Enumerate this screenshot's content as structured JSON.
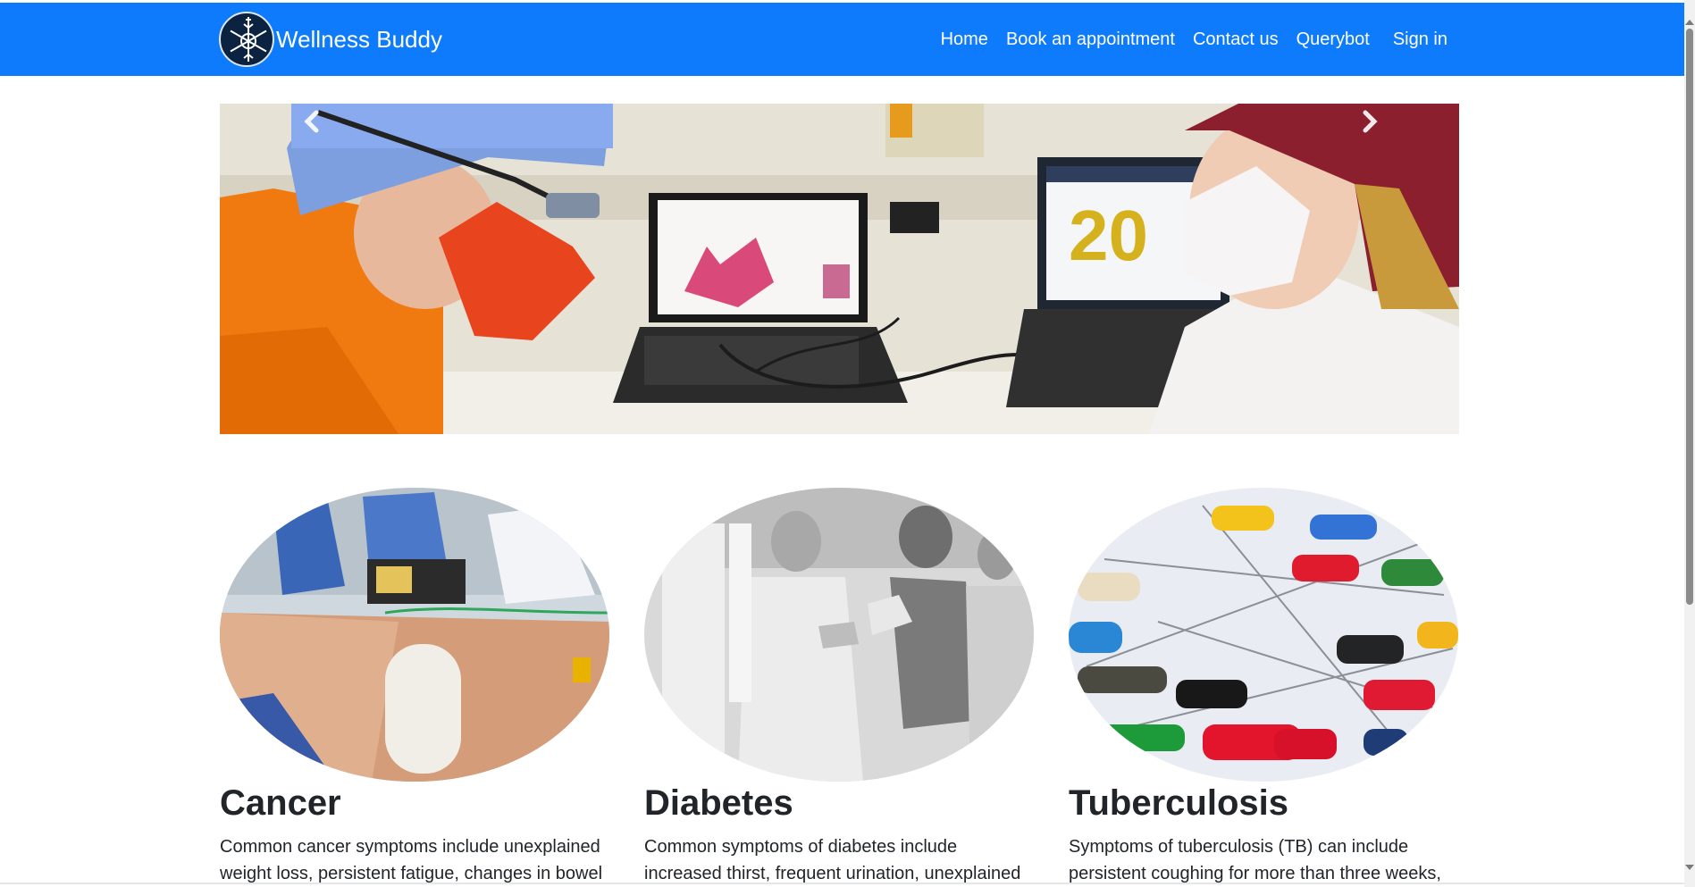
{
  "brand": {
    "name": "Wellness Buddy",
    "logo_icon": "snowflake-emblem-icon"
  },
  "nav": {
    "items": [
      {
        "label": "Home"
      },
      {
        "label": "Book an appointment"
      },
      {
        "label": "Contact us"
      },
      {
        "label": "Querybot"
      }
    ],
    "signin": "Sign in"
  },
  "carousel": {
    "prev_icon": "chevron-left-icon",
    "next_icon": "chevron-right-icon",
    "slide_text": "20"
  },
  "cards": [
    {
      "title": "Cancer",
      "text": "Common cancer symptoms include unexplained weight loss, persistent fatigue, changes in bowel"
    },
    {
      "title": "Diabetes",
      "text": "Common symptoms of diabetes include increased thirst, frequent urination, unexplained"
    },
    {
      "title": "Tuberculosis",
      "text": "Symptoms of tuberculosis (TB) can include persistent coughing for more than three weeks,"
    }
  ],
  "colors": {
    "navbar": "#0d7bfb",
    "text": "#212529"
  }
}
